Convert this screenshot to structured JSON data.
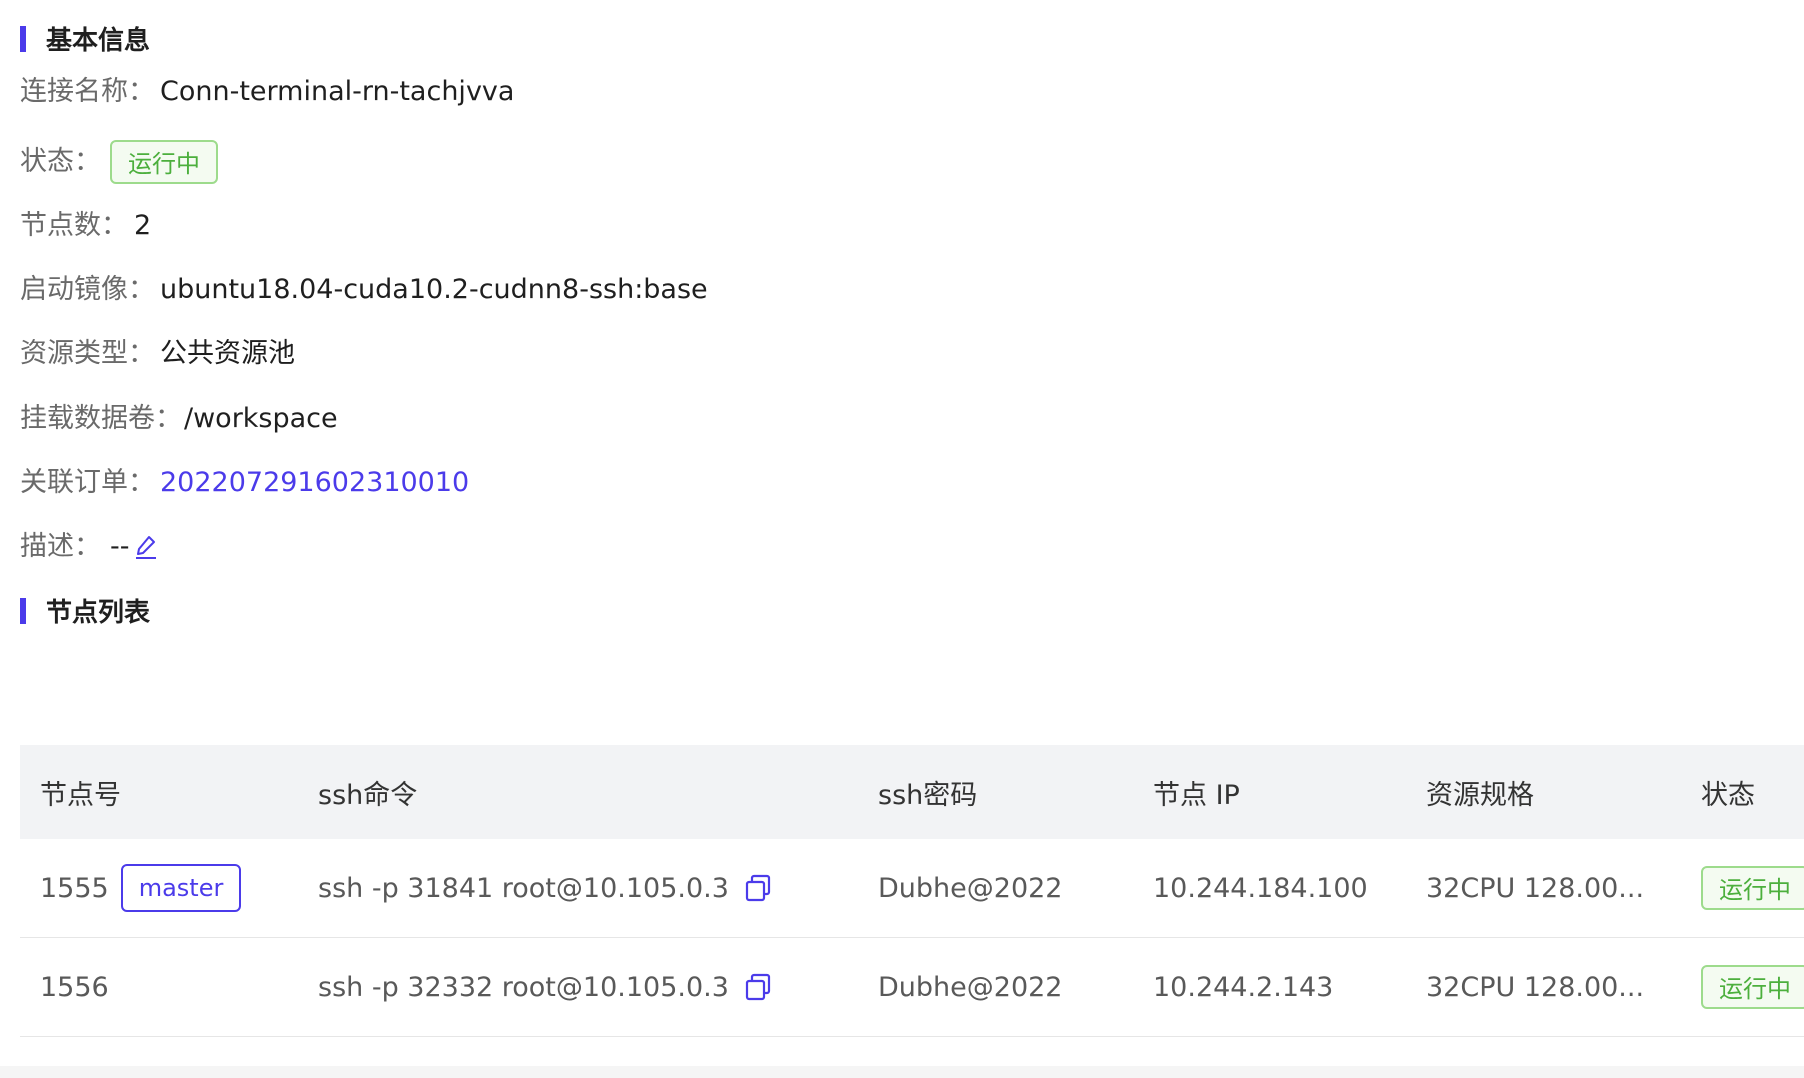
{
  "basic_info": {
    "title": "基本信息",
    "conn_name_label": "连接名称：",
    "conn_name_value": "Conn-terminal-rn-tachjvva",
    "status_label": "状态：",
    "status_value": "运行中",
    "node_count_label": "节点数：",
    "node_count_value": "2",
    "image_label": "启动镜像：",
    "image_value": "ubuntu18.04-cuda10.2-cudnn8-ssh:base",
    "resource_type_label": "资源类型：",
    "resource_type_value": "公共资源池",
    "volume_label": "挂载数据卷：",
    "volume_value": "/workspace",
    "order_label": "关联订单：",
    "order_value": "202207291602310010",
    "desc_label": "描述：",
    "desc_value": "--"
  },
  "node_list": {
    "title": "节点列表",
    "columns": [
      "节点号",
      "ssh命令",
      "ssh密码",
      "节点 IP",
      "资源规格",
      "状态"
    ],
    "rows": [
      {
        "node_id": "1555",
        "badge": "master",
        "ssh_command": "ssh -p 31841 root@10.105.0.3",
        "ssh_password": "Dubhe@2022",
        "ip": "10.244.184.100",
        "spec": "32CPU 128.00...",
        "status": "运行中"
      },
      {
        "node_id": "1556",
        "badge": "",
        "ssh_command": "ssh -p 32332 root@10.105.0.3",
        "ssh_password": "Dubhe@2022",
        "ip": "10.244.2.143",
        "spec": "32CPU 128.00...",
        "status": "运行中"
      }
    ]
  },
  "colors": {
    "accent": "#4b3bea",
    "running_text": "#4caf3d",
    "running_border": "#9ddb8c",
    "header_bg": "#f2f3f5"
  },
  "icons": {
    "edit": "edit-pencil-icon",
    "copy": "copy-icon"
  }
}
